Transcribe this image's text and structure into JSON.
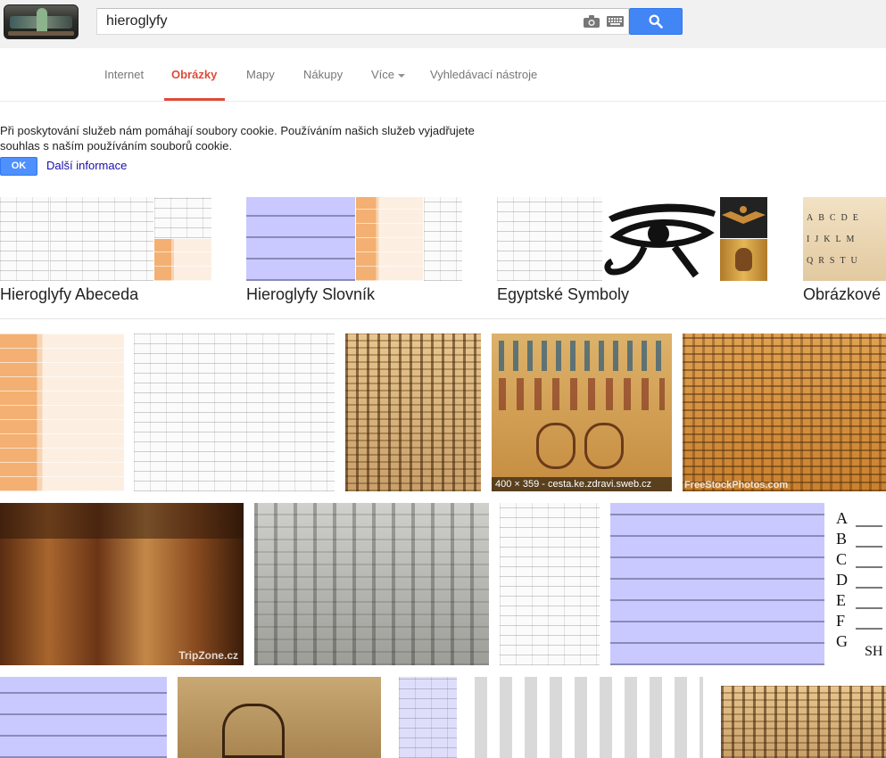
{
  "search": {
    "query": "hieroglyfy"
  },
  "tabs": [
    {
      "label": "Internet"
    },
    {
      "label": "Obrázky"
    },
    {
      "label": "Mapy"
    },
    {
      "label": "Nákupy"
    },
    {
      "label": "Více"
    },
    {
      "label": "Vyhledávací nástroje"
    }
  ],
  "cookie": {
    "text": "Při poskytování služeb nám pomáhají soubory cookie. Používáním našich služeb vyjadřujete souhlas s naším používáním souborů cookie.",
    "ok_label": "OK",
    "more_label": "Další informace"
  },
  "related": [
    {
      "label": "Hieroglyfy Abeceda"
    },
    {
      "label": "Hieroglyfy Slovník"
    },
    {
      "label": "Egyptské Symboly"
    },
    {
      "label": "Obrázkové"
    }
  ],
  "results": {
    "hover_caption": "400 × 359 - cesta.ke.zdravi.sweb.cz",
    "watermark_freestock": "FreeStockPhotos.com",
    "watermark_tripzone": "TripZone",
    "watermark_tripzone_suffix": ".cz",
    "alphabet_letters": [
      "A",
      "B",
      "C",
      "D",
      "E",
      "F",
      "G",
      "SH"
    ]
  },
  "colors": {
    "accent_red": "#dd4b39",
    "search_blue": "#4285f4",
    "link_blue": "#1a0dab"
  }
}
